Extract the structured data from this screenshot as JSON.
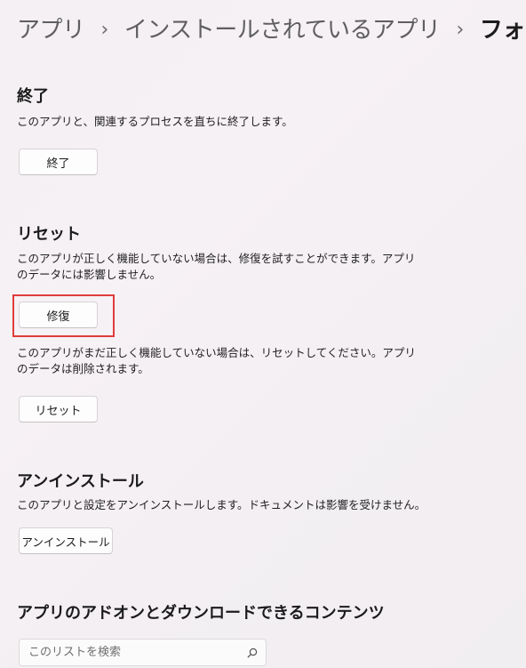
{
  "breadcrumb": {
    "items": [
      "アプリ",
      "インストールされているアプリ",
      "フォト"
    ],
    "separator": "›"
  },
  "terminate": {
    "title": "終了",
    "description": "このアプリと、関連するプロセスを直ちに終了します。",
    "button_label": "終了"
  },
  "reset": {
    "title": "リセット",
    "repair_description": "このアプリが正しく機能していない場合は、修復を試すことができます。アプリのデータには影響しません。",
    "repair_button_label": "修復",
    "reset_description": "このアプリがまだ正しく機能していない場合は、リセットしてください。アプリのデータは削除されます。",
    "reset_button_label": "リセット"
  },
  "uninstall": {
    "title": "アンインストール",
    "description": "このアプリと設定をアンインストールします。ドキュメントは影響を受けません。",
    "button_label": "アンインストール"
  },
  "addons": {
    "title": "アプリのアドオンとダウンロードできるコンテンツ",
    "search_placeholder": "このリストを検索",
    "search_value": ""
  },
  "colors": {
    "highlight_border": "#e03c3c",
    "background": "#f5f0f4"
  },
  "icons": {
    "breadcrumb_separator": "chevron-right-icon",
    "search": "search-icon"
  }
}
